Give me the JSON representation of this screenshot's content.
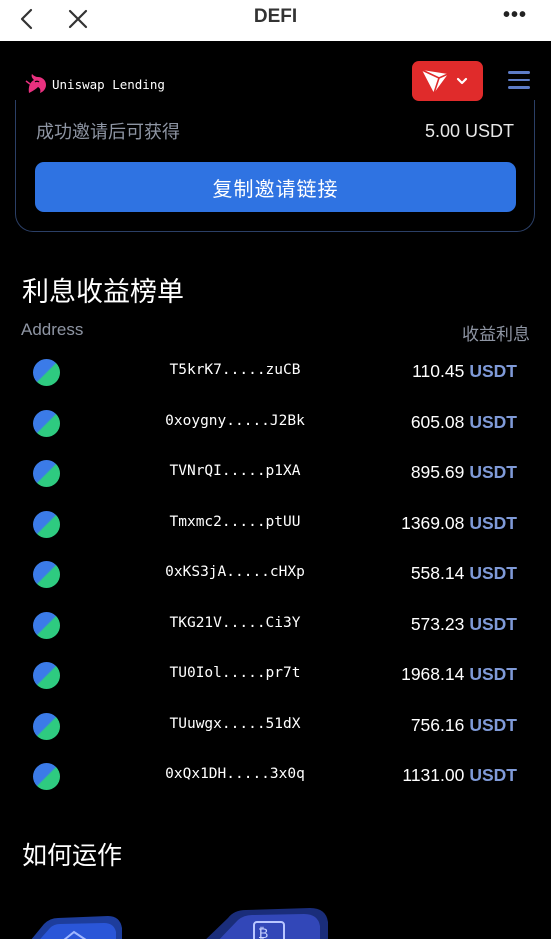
{
  "topbar": {
    "title": "DEFI",
    "more": "•••"
  },
  "header": {
    "logo_text": "Uniswap Lending",
    "chain_icon": "tron-icon"
  },
  "invite": {
    "reward_label": "成功邀请后可获得",
    "reward_value": "5.00 USDT",
    "copy_button": "复制邀请链接"
  },
  "ranking": {
    "title": "利息收益榜单",
    "col_address": "Address",
    "col_income": "收益利息",
    "unit": "USDT",
    "rows": [
      {
        "address": "T5krK7.....zuCB",
        "amount": "110.45"
      },
      {
        "address": "0xoygny.....J2Bk",
        "amount": "605.08"
      },
      {
        "address": "TVNrQI.....p1XA",
        "amount": "895.69"
      },
      {
        "address": "Tmxmc2.....ptUU",
        "amount": "1369.08"
      },
      {
        "address": "0xKS3jA.....cHXp",
        "amount": "558.14"
      },
      {
        "address": "TKG21V.....Ci3Y",
        "amount": "573.23"
      },
      {
        "address": "TU0Iol.....pr7t",
        "amount": "1968.14"
      },
      {
        "address": "TUuwgx.....51dX",
        "amount": "756.16"
      },
      {
        "address": "0xQx1DH.....3x0q",
        "amount": "1131.00"
      }
    ]
  },
  "how": {
    "title": "如何运作"
  },
  "colors": {
    "accent": "#2f73e2",
    "chain": "#e02b2b",
    "unit": "#7f9ad8",
    "border": "#2b3f66"
  }
}
